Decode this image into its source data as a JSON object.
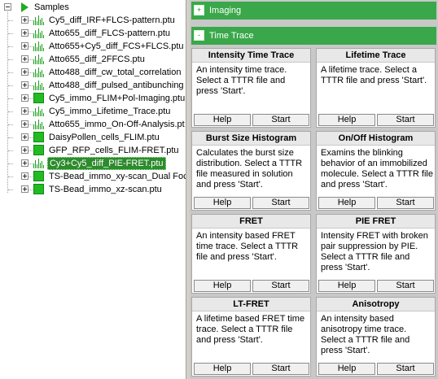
{
  "tree": {
    "root": {
      "label": "Samples"
    },
    "items": [
      {
        "label": "Cy5_diff_IRF+FLCS-pattern.ptu",
        "icon": "trace",
        "selected": false
      },
      {
        "label": "Atto655_diff_FLCS-pattern.ptu",
        "icon": "trace",
        "selected": false
      },
      {
        "label": "Atto655+Cy5_diff_FCS+FLCS.ptu",
        "icon": "trace",
        "selected": false
      },
      {
        "label": "Atto655_diff_2FFCS.ptu",
        "icon": "trace",
        "selected": false
      },
      {
        "label": "Atto488_diff_cw_total_correlation",
        "icon": "trace",
        "selected": false
      },
      {
        "label": "Atto488_diff_pulsed_antibunching",
        "icon": "trace",
        "selected": false
      },
      {
        "label": "Cy5_immo_FLIM+Pol-Imaging.ptu",
        "icon": "image",
        "selected": false
      },
      {
        "label": "Cy5_immo_Lifetime_Trace.ptu",
        "icon": "trace",
        "selected": false
      },
      {
        "label": "Atto655_immo_On-Off-Analysis.pt",
        "icon": "trace",
        "selected": false
      },
      {
        "label": "DaisyPollen_cells_FLIM.ptu",
        "icon": "image",
        "selected": false
      },
      {
        "label": "GFP_RFP_cells_FLIM-FRET.ptu",
        "icon": "image",
        "selected": false
      },
      {
        "label": "Cy3+Cy5_diff_PIE-FRET.ptu",
        "icon": "trace",
        "selected": true
      },
      {
        "label": "TS-Bead_immo_xy-scan_Dual Foc",
        "icon": "image",
        "selected": false
      },
      {
        "label": "TS-Bead_immo_xz-scan.ptu",
        "icon": "image",
        "selected": false
      }
    ]
  },
  "sections": [
    {
      "label": "Imaging",
      "expanded": false,
      "toggle": "+"
    },
    {
      "label": "Time Trace",
      "expanded": true,
      "toggle": "-"
    }
  ],
  "cards": [
    {
      "title": "Intensity Time Trace",
      "desc": "An intensity time trace. Select a TTTR file and press 'Start'.",
      "help": "Help",
      "start": "Start"
    },
    {
      "title": "Lifetime Trace",
      "desc": "A lifetime trace. Select a TTTR file and press 'Start'.",
      "help": "Help",
      "start": "Start"
    },
    {
      "title": "Burst Size Histogram",
      "desc": "Calculates the burst size distribution. Select a TTTR file measured in solution and press 'Start'.",
      "help": "Help",
      "start": "Start"
    },
    {
      "title": "On/Off Histogram",
      "desc": "Examins the blinking behavior of an immobilized molecule. Select a TTTR file and press 'Start'.",
      "help": "Help",
      "start": "Start"
    },
    {
      "title": "FRET",
      "desc": "An intensity based FRET time trace. Select a TTTR file and press 'Start'.",
      "help": "Help",
      "start": "Start"
    },
    {
      "title": "PIE FRET",
      "desc": "Intensity FRET with broken pair suppression by PIE. Select a TTTR file and press 'Start'.",
      "help": "Help",
      "start": "Start"
    },
    {
      "title": "LT-FRET",
      "desc": "A lifetime based FRET time trace. Select a TTTR file and press 'Start'.",
      "help": "Help",
      "start": "Start"
    },
    {
      "title": "Anisotropy",
      "desc": "An intensity based anisotropy time trace. Select a TTTR file and press 'Start'.",
      "help": "Help",
      "start": "Start"
    }
  ],
  "colors": {
    "header_green": "#3aa84a",
    "selection_green": "#2d8a2d",
    "panel_gray": "#c8c8c8"
  }
}
